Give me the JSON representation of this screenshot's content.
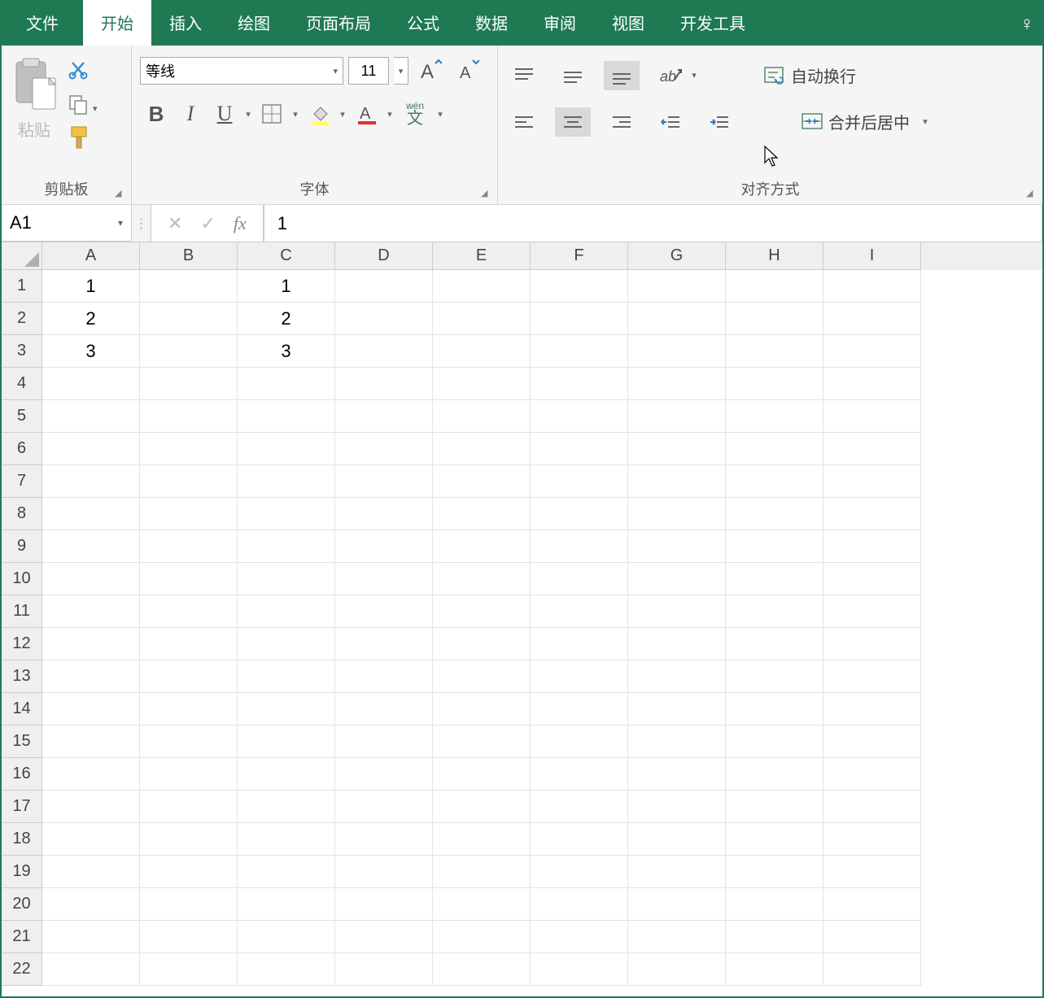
{
  "tabs": {
    "file": "文件",
    "home": "开始",
    "insert": "插入",
    "draw": "绘图",
    "pageLayout": "页面布局",
    "formulas": "公式",
    "data": "数据",
    "review": "审阅",
    "view": "视图",
    "developer": "开发工具"
  },
  "ribbon": {
    "clipboard": {
      "paste": "粘贴",
      "groupLabel": "剪贴板"
    },
    "font": {
      "name": "等线",
      "size": "11",
      "groupLabel": "字体"
    },
    "alignment": {
      "wrapText": "自动换行",
      "mergeCenter": "合并后居中",
      "groupLabel": "对齐方式"
    },
    "wenzi": "wén",
    "wenziChar": "文"
  },
  "formulaBar": {
    "nameBox": "A1",
    "fxLabel": "fx",
    "value": "1"
  },
  "grid": {
    "columns": [
      "A",
      "B",
      "C",
      "D",
      "E",
      "F",
      "G",
      "H",
      "I"
    ],
    "rowCount": 22,
    "cells": {
      "A1": "1",
      "A2": "2",
      "A3": "3",
      "C1": "1",
      "C2": "2",
      "C3": "3"
    }
  }
}
